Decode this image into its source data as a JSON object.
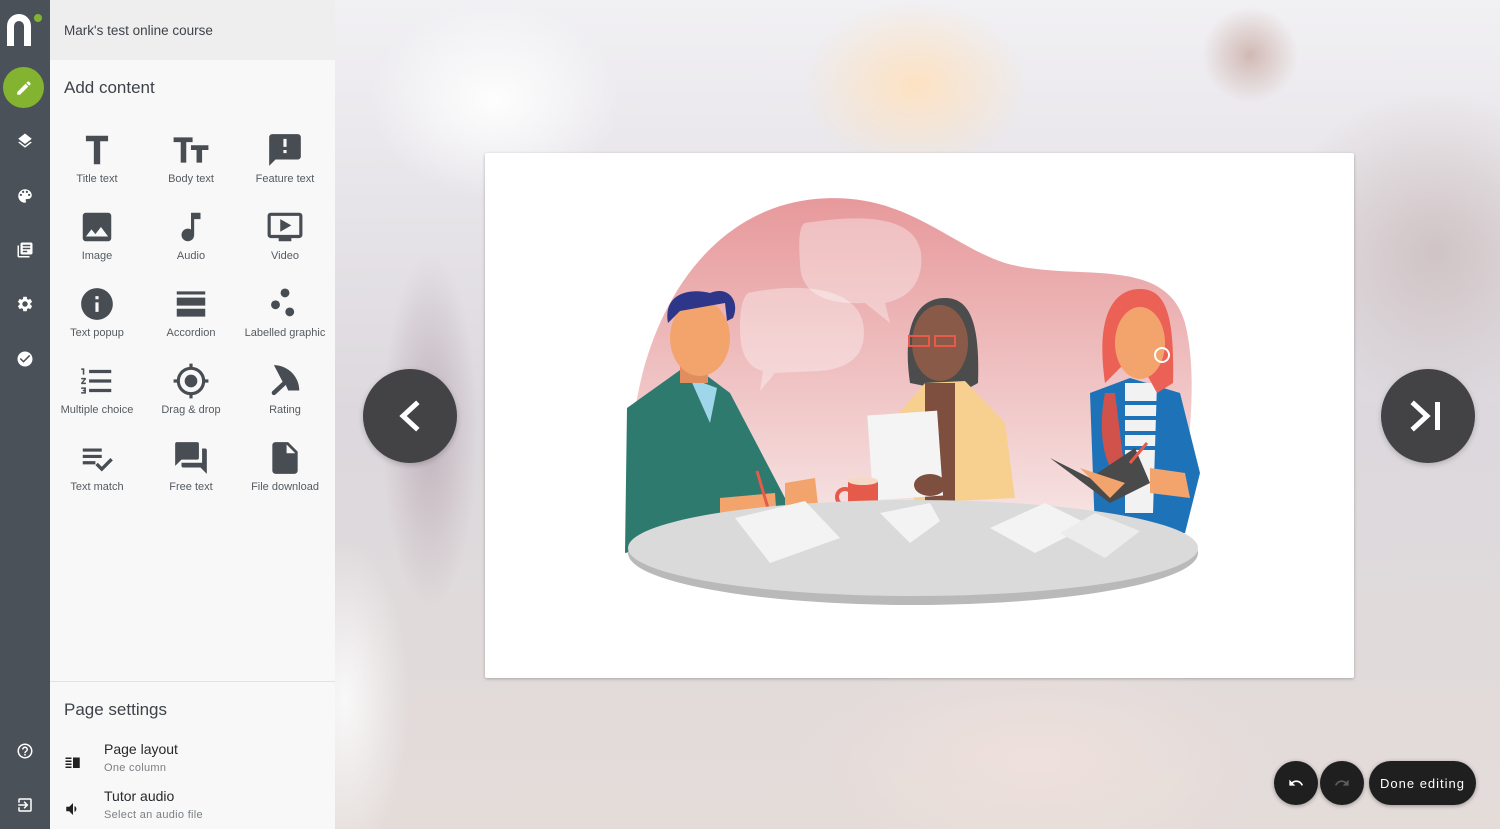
{
  "app": {
    "course_title": "Mark's test online course",
    "brand_color": "#83b431",
    "rail_color": "#4a5158"
  },
  "rail": {
    "items": [
      {
        "name": "edit",
        "icon": "pencil-icon",
        "active": true
      },
      {
        "name": "layers",
        "icon": "layers-icon",
        "active": false
      },
      {
        "name": "theme",
        "icon": "palette-icon",
        "active": false
      },
      {
        "name": "pages",
        "icon": "library-icon",
        "active": false
      },
      {
        "name": "settings",
        "icon": "gear-icon",
        "active": false
      },
      {
        "name": "publish",
        "icon": "check-circle-icon",
        "active": false
      }
    ],
    "bottom_items": [
      {
        "name": "help",
        "icon": "help-circle-icon"
      },
      {
        "name": "exit",
        "icon": "exit-icon"
      }
    ]
  },
  "add_content": {
    "title": "Add content",
    "items": [
      {
        "label": "Title text",
        "icon": "title-text-icon"
      },
      {
        "label": "Body text",
        "icon": "body-text-icon"
      },
      {
        "label": "Feature text",
        "icon": "feature-text-icon"
      },
      {
        "label": "Image",
        "icon": "image-icon"
      },
      {
        "label": "Audio",
        "icon": "music-note-icon"
      },
      {
        "label": "Video",
        "icon": "video-icon"
      },
      {
        "label": "Text popup",
        "icon": "info-icon"
      },
      {
        "label": "Accordion",
        "icon": "accordion-icon"
      },
      {
        "label": "Labelled graphic",
        "icon": "labelled-graphic-icon"
      },
      {
        "label": "Multiple choice",
        "icon": "numbered-list-icon"
      },
      {
        "label": "Drag & drop",
        "icon": "target-icon"
      },
      {
        "label": "Rating",
        "icon": "rating-gauge-icon"
      },
      {
        "label": "Text match",
        "icon": "text-match-icon"
      },
      {
        "label": "Free text",
        "icon": "chat-bubbles-icon"
      },
      {
        "label": "File download",
        "icon": "file-icon"
      }
    ]
  },
  "page_settings": {
    "title": "Page settings",
    "items": [
      {
        "label": "Page layout",
        "value": "One column",
        "icon": "layout-icon"
      },
      {
        "label": "Tutor audio",
        "value": "Select an audio file",
        "icon": "speaker-icon"
      }
    ]
  },
  "stage": {
    "slide_image": "illustration-three-people-meeting-at-table",
    "prev_icon": "chevron-left-icon",
    "next_icon": "skip-next-icon",
    "toolbar": {
      "undo_icon": "undo-icon",
      "redo_icon": "redo-icon",
      "redo_enabled": false,
      "done_label": "Done editing"
    }
  }
}
